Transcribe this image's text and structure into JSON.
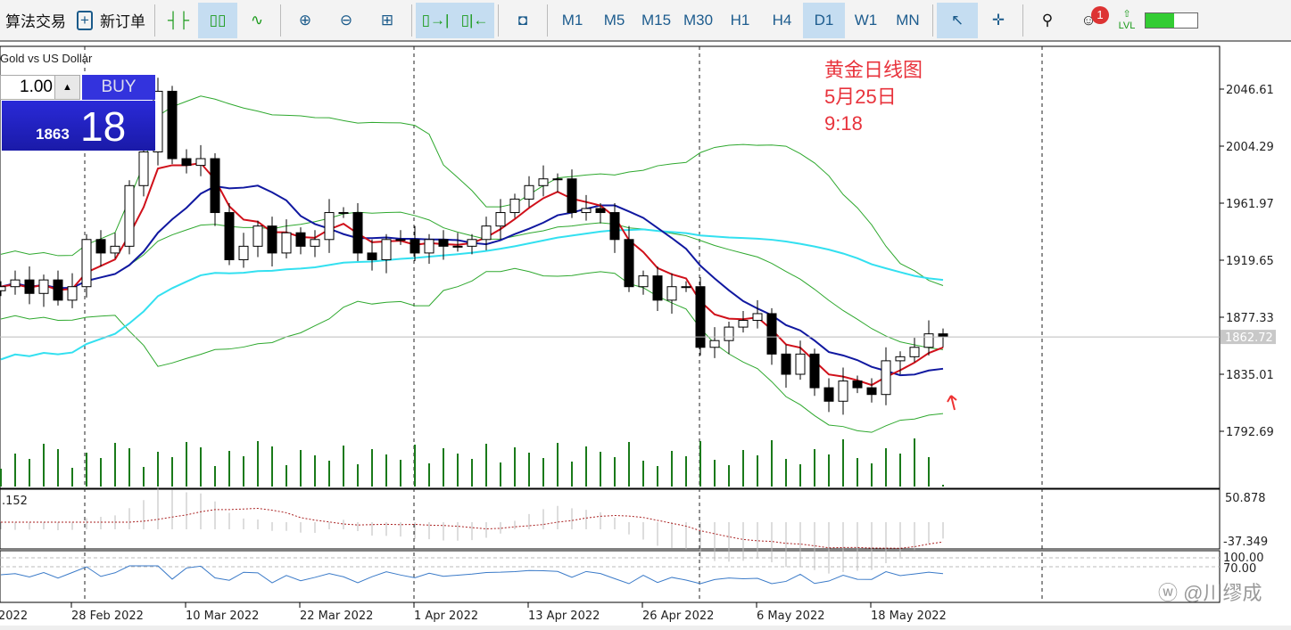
{
  "toolbar": {
    "algo": "算法交易",
    "new_order": "新订单",
    "notif_count": "1",
    "lvl": "LVL",
    "timeframes": [
      "M1",
      "M5",
      "M15",
      "M30",
      "H1",
      "H4",
      "D1",
      "W1",
      "MN"
    ],
    "active_tf": "D1"
  },
  "trade_panel": {
    "symbol": "Gold vs US Dollar",
    "lot": "1.00",
    "buy_label": "BUY",
    "price_big": "1863",
    "price_small": "18"
  },
  "annotation": {
    "line1": "黄金日线图",
    "line2": "5月25日",
    "line3": "9:18"
  },
  "watermark": "@川缪成",
  "colors": {
    "up": "#ffffff",
    "down": "#000000",
    "band": "#2ea82e",
    "ema": "#d0101a",
    "sma": "#1018a0",
    "slow": "#33e0f0",
    "volume": "#1a7a1a",
    "osc": "#3a7ac8",
    "accent": "#c5ddf1"
  },
  "chart_data": {
    "type": "candlestick",
    "price_ticks": [
      "2046.61",
      "2004.29",
      "1961.97",
      "1919.65",
      "1877.33",
      "1835.01",
      "1792.69"
    ],
    "ylim": [
      1792.69,
      2046.61
    ],
    "current_price": "1862.72",
    "date_labels": [
      "2022",
      "28 Feb 2022",
      "10 Mar 2022",
      "22 Mar 2022",
      "1 Apr 2022",
      "13 Apr 2022",
      "26 Apr 2022",
      "6 May 2022",
      "18 May 2022"
    ],
    "closes": [
      1900,
      1905,
      1895,
      1905,
      1890,
      1900,
      1935,
      1925,
      1930,
      1975,
      2000,
      2045,
      1995,
      1990,
      1995,
      1955,
      1920,
      1930,
      1945,
      1925,
      1940,
      1930,
      1935,
      1955,
      1955,
      1925,
      1920,
      1935,
      1935,
      1925,
      1935,
      1930,
      1930,
      1935,
      1945,
      1955,
      1965,
      1975,
      1980,
      1980,
      1955,
      1958,
      1955,
      1935,
      1900,
      1908,
      1890,
      1900,
      1900,
      1855,
      1860,
      1870,
      1875,
      1880,
      1850,
      1835,
      1850,
      1825,
      1815,
      1830,
      1825,
      1820,
      1845,
      1848,
      1855,
      1865,
      1863
    ],
    "osc1": {
      "label": ".152",
      "max": "50.878",
      "min": "-37.349"
    },
    "osc2": {
      "levels": [
        "100.00",
        "70.00"
      ]
    }
  }
}
